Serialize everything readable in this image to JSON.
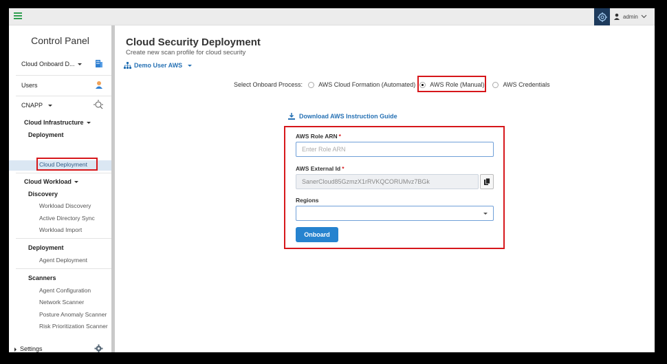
{
  "topbar": {
    "user_name": "admin",
    "icons": [
      "menu-icon",
      "settings-icon",
      "user-icon",
      "chevron-down-icon"
    ]
  },
  "sidebar": {
    "title": "Control Panel",
    "cloud_onboard_label": "Cloud Onboard D...",
    "users_label": "Users",
    "cnapp_label": "CNAPP",
    "cloud_infrastructure_label": "Cloud Infrastructure",
    "deployment_label": "Deployment",
    "cloud_deployment_label": "Cloud Deployment",
    "cloud_workload_label": "Cloud Workload",
    "discovery_label": "Discovery",
    "workload_discovery_label": "Workload Discovery",
    "active_directory_sync_label": "Active Directory Sync",
    "workload_import_label": "Workload Import",
    "deployment2_label": "Deployment",
    "agent_deployment_label": "Agent Deployment",
    "scanners_label": "Scanners",
    "agent_configuration_label": "Agent Configuration",
    "network_scanner_label": "Network Scanner",
    "posture_anomaly_scanner_label": "Posture Anomaly Scanner",
    "risk_prioritization_scanner_label": "Risk Prioritization Scanner",
    "settings_label": "Settings"
  },
  "main": {
    "title": "Cloud Security Deployment",
    "subtitle": "Create new scan profile for cloud security",
    "account_label": "Demo User AWS",
    "process_label": "Select Onboard Process:",
    "options": [
      {
        "label": "AWS Cloud Formation (Automated)",
        "checked": false
      },
      {
        "label": "AWS Role (Manual)",
        "checked": true
      },
      {
        "label": "AWS Credentials",
        "checked": false
      }
    ],
    "download_label": "Download AWS Instruction Guide",
    "form": {
      "role_arn_label": "AWS Role ARN",
      "role_arn_placeholder": "Enter Role ARN",
      "external_id_label": "AWS External Id",
      "external_id_value": "SanerCloud85GzmzX1rRVKQCORUMvz7BGk",
      "regions_label": "Regions",
      "required_mark": "*",
      "onboard_label": "Onboard"
    }
  },
  "colors": {
    "accent": "#2671b4",
    "button": "#2683cf",
    "highlight_red": "#d6161a",
    "menu_green": "#2e9e4f",
    "gear_bg": "#1d3a5c"
  }
}
